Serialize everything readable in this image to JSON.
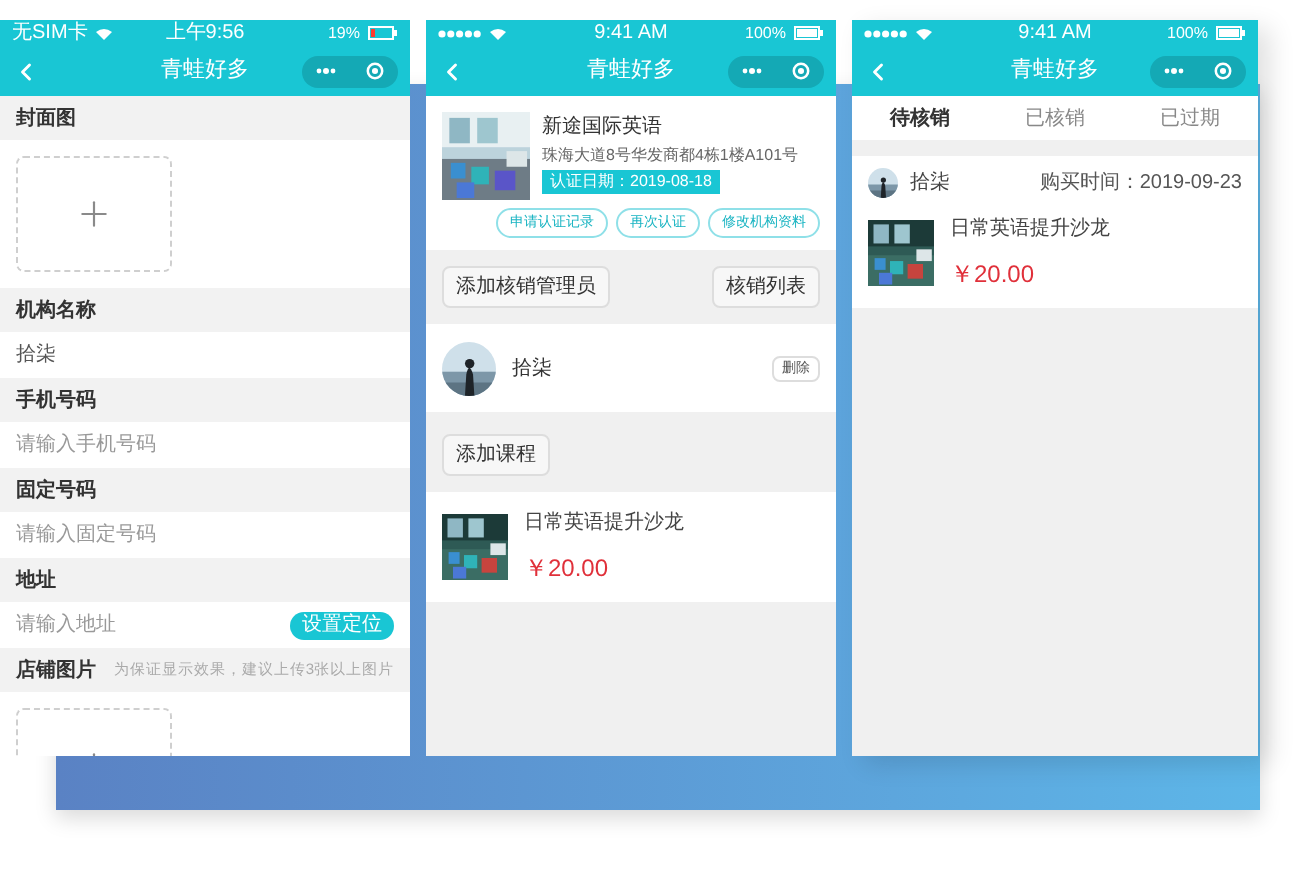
{
  "form_screen": {
    "status": {
      "carrier": "无SIM卡",
      "time": "上午9:56",
      "battery": "19%"
    },
    "title": "青蛙好多",
    "fields": [
      {
        "kind": "upload",
        "label": "封面图"
      },
      {
        "kind": "input",
        "label": "机构名称",
        "value": "拾柒"
      },
      {
        "kind": "input",
        "label": "手机号码",
        "placeholder": "请输入手机号码"
      },
      {
        "kind": "input",
        "label": "固定号码",
        "placeholder": "请输入固定号码"
      },
      {
        "kind": "input",
        "label": "地址",
        "placeholder": "请输入地址",
        "button": "设置定位"
      },
      {
        "kind": "upload",
        "label": "店铺图片",
        "hint": "为保证显示效果，建议上传3张以上图片"
      }
    ]
  },
  "org_screen": {
    "status": {
      "time": "9:41 AM",
      "battery": "100%"
    },
    "title": "青蛙好多",
    "org": {
      "name": "新途国际英语",
      "address": "珠海大道8号华发商都4栋1楼A101号",
      "badge": "认证日期：2019-08-18",
      "actions": [
        "申请认证记录",
        "再次认证",
        "修改机构资料"
      ]
    },
    "manager_buttons": [
      "添加核销管理员",
      "核销列表"
    ],
    "managers": [
      {
        "name": "拾柒",
        "action": "删除"
      }
    ],
    "add_course": "添加课程",
    "courses": [
      {
        "title": "日常英语提升沙龙",
        "price": "￥20.00"
      }
    ]
  },
  "orders_screen": {
    "status": {
      "time": "9:41 AM",
      "battery": "100%"
    },
    "title": "青蛙好多",
    "tabs": [
      {
        "label": "待核销",
        "selected": true
      },
      {
        "label": "已核销",
        "selected": false
      },
      {
        "label": "已过期",
        "selected": false
      }
    ],
    "orders": [
      {
        "buyer": "拾柒",
        "time": "购买时间：2019-09-23",
        "title": "日常英语提升沙龙",
        "price": "￥20.00"
      }
    ]
  }
}
